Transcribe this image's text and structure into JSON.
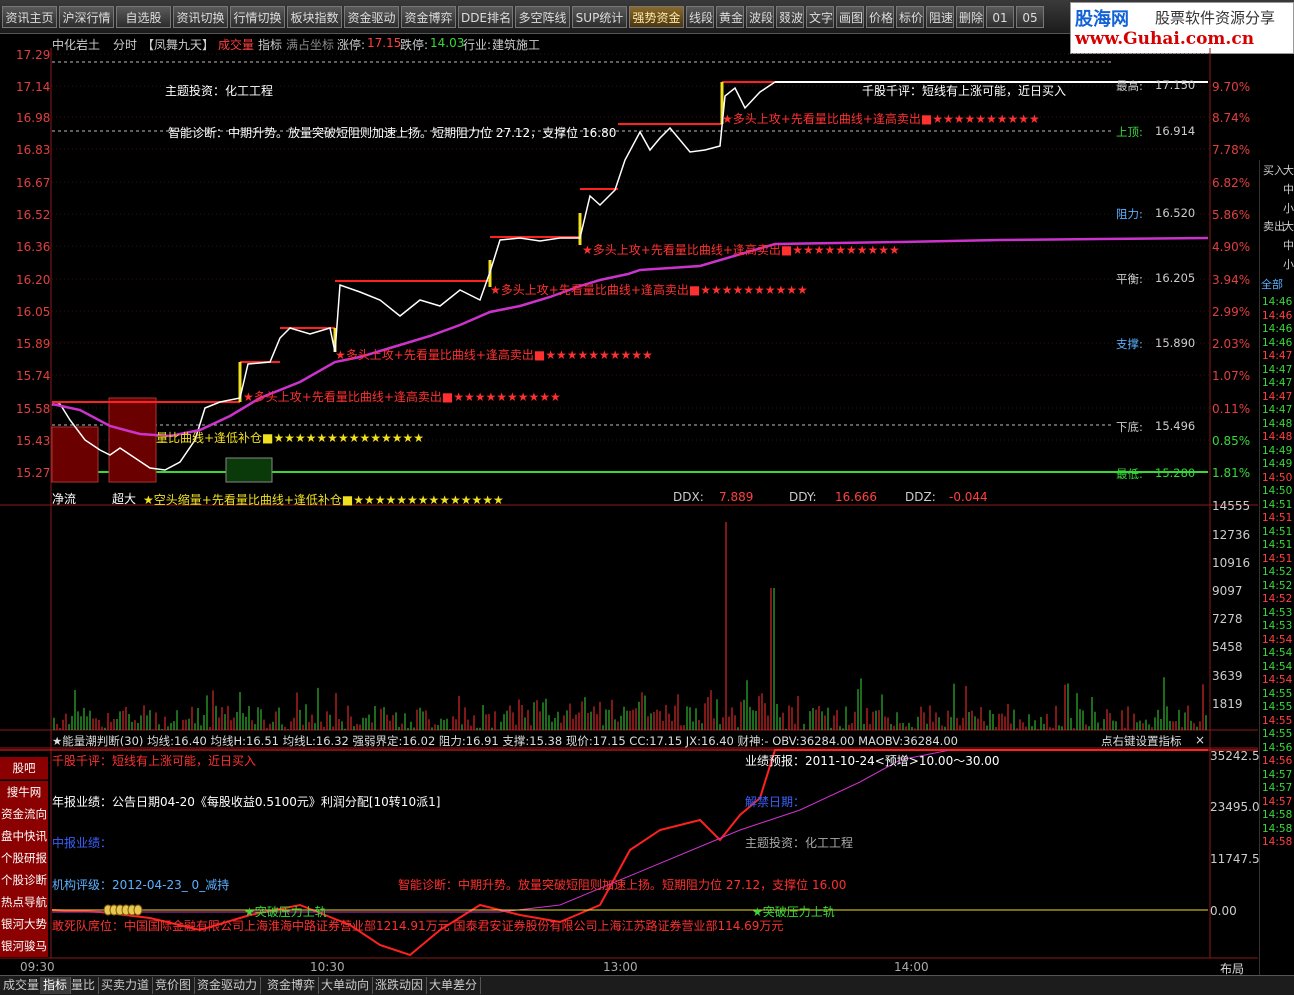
{
  "toolbar": {
    "items": [
      "资讯主页",
      "沪深行情",
      "自选股",
      "资讯切换",
      "行情切换",
      "板块指数",
      "资金驱动",
      "资金博弈",
      "DDE排名",
      "多空阵线",
      "SUP统计",
      "强势资金",
      "线段",
      "黄金",
      "波段",
      "叕波",
      "文字",
      "画图",
      "价格",
      "标价",
      "阻速",
      "删除",
      "01",
      "05"
    ],
    "active": "强势资金"
  },
  "brand": {
    "name": "股海网",
    "slogan": "股票软件资源分享",
    "url": "www.Guhai.com.cn"
  },
  "title": {
    "stock": "中化岩土",
    "mode": "分时",
    "formula": "【凤舞九天】",
    "cjl": "成交量",
    "zhibiao": "指标",
    "manzhan": "满占坐标",
    "zhangting_label": "涨停:",
    "zhangting": "17.15",
    "dieting_label": "跌停:",
    "dieting": "14.03",
    "industry_label": "行业:",
    "industry": "建筑施工"
  },
  "price_axis": {
    "left": [
      "17.29",
      "17.14",
      "16.98",
      "16.83",
      "16.67",
      "16.52",
      "16.36",
      "16.20",
      "16.05",
      "15.89",
      "15.74",
      "15.58",
      "15.43",
      "15.27"
    ],
    "right": [
      "9.70%",
      "8.74%",
      "7.78%",
      "6.82%",
      "5.86%",
      "4.90%",
      "3.94%",
      "2.99%",
      "2.03%",
      "1.07%",
      "0.11%",
      "0.85%",
      "1.81%"
    ]
  },
  "levels": [
    {
      "label": "最高:",
      "value": "17.150"
    },
    {
      "label": "上顶:",
      "value": "16.914"
    },
    {
      "label": "阻力:",
      "value": "16.520"
    },
    {
      "label": "平衡:",
      "value": "16.205"
    },
    {
      "label": "支撑:",
      "value": "15.890"
    },
    {
      "label": "下底:",
      "value": "15.496"
    },
    {
      "label": "最低:",
      "value": "15.280"
    }
  ],
  "chart_texts": {
    "zhuti": "主题投资：化工工程",
    "qiangu": "千股千评：短线有上涨可能，近日买入",
    "zhenduan": "智能诊断：中期升势。放量突破短阻则加速上扬。短期阻力位 27.12，支撑位 16.80",
    "signal1": "★多头上攻+先看量比曲线+逢高卖出■★★★★★★★★★★",
    "signal_buy": "量比曲线+逢低补仓■★★★★★★★★★★★★★★",
    "signal_bottom": "★空头缩量+先看量比曲线+逢低补仓■★★★★★★★★★★★★★★",
    "jingliu": "净流",
    "chaoda": "超大",
    "ddx_label": "DDX:",
    "ddx": "7.889",
    "ddy_label": "DDY:",
    "ddy": "16.666",
    "ddz_label": "DDZ:",
    "ddz": "-0.044"
  },
  "volume_axis": [
    "14555",
    "12736",
    "10916",
    "9097",
    "7278",
    "5458",
    "3639",
    "1819"
  ],
  "indicator_bar": {
    "text": "★能量潮判断(30)  均线:16.40  均线H:16.51  均线L:16.32  强弱界定:16.02  阻力:16.91  支撑:15.38  现价:17.15  CC:17.15  JX:16.40  财神:-  OBV:36284.00  MAOBV:36284.00",
    "hint": "点右键设置指标",
    "close": "×"
  },
  "bottom_texts": {
    "qiangu": "千股千评：短线有上涨可能，近日买入",
    "yejiyubao": "业绩预报：2011-10-24<预增>10.00～30.00",
    "nianbao": "年报业绩：公告日期04-20《每股收益0.5100元》利润分配[10转10派1]",
    "jiejin": "解禁日期：",
    "zhongbao": "中报业绩：",
    "zhuti": "主题投资：化工工程",
    "jigou": "机构评级：2012-04-23_ 0_减持",
    "zhenduan": "智能诊断：中期升势。放量突破短阻则加速上扬。短期阻力位 27.12，支撑位 16.00",
    "tupo": "★突破压力上轨",
    "tupo2": "★突破压力上轨",
    "gansi": "敢死队席位：中国国际金融有限公司上海淮海中路证券营业部1214.91万元  国泰君安证券股份有限公司上海江苏路证券营业部114.69万元"
  },
  "obv_axis": [
    "35242.50",
    "23495.00",
    "11747.50",
    "0.00"
  ],
  "time_axis": [
    "09:30",
    "10:30",
    "13:00",
    "14:00"
  ],
  "layout_btn": "布局",
  "left_menu": [
    "股吧",
    "搜牛网",
    "资金流向",
    "盘中快讯",
    "个股研报",
    "个股诊断",
    "热点导航",
    "银河大势",
    "银河骏马"
  ],
  "bottom_tabs": [
    "成交量",
    "指标",
    "量比",
    "买卖力道",
    "竞价图",
    "资金驱动力",
    "资金博弈",
    "大单动向",
    "涨跌动因",
    "大单差分"
  ],
  "bottom_active": "指标",
  "right_panel": {
    "buy": "买入",
    "sell": "卖出",
    "da": "大",
    "zhong": "中",
    "xiao": "小",
    "all": "全部",
    "times": [
      "14:46",
      "14:46",
      "14:46",
      "14:46",
      "14:47",
      "14:47",
      "14:47",
      "14:47",
      "14:47",
      "14:48",
      "14:48",
      "14:49",
      "14:49",
      "14:50",
      "14:50",
      "14:51",
      "14:51",
      "14:51",
      "14:51",
      "14:51",
      "14:52",
      "14:52",
      "14:52",
      "14:53",
      "14:53",
      "14:54",
      "14:54",
      "14:54",
      "14:54",
      "14:55",
      "14:55",
      "14:55",
      "14:55",
      "14:56",
      "14:56",
      "14:57",
      "14:57",
      "14:57",
      "14:58",
      "14:58",
      "14:58"
    ]
  },
  "colors": {
    "up": "#ff3030",
    "down": "#39d839",
    "price": "#ffffff",
    "avg": "#cc33cc",
    "signal": "#ff2020",
    "star_yellow": "#f0e020"
  }
}
